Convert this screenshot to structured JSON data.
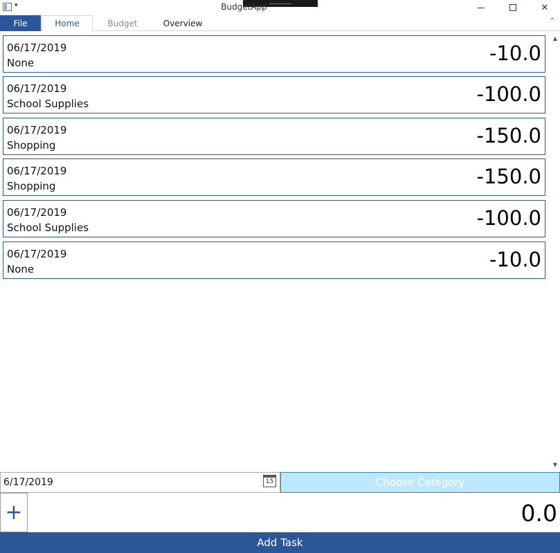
{
  "window": {
    "title": "BudgetApp",
    "qat_arrow": "▾",
    "close_glyph": "✕"
  },
  "ribbon": {
    "tabs": [
      {
        "label": "File",
        "state": "active-application-menu"
      },
      {
        "label": "Home",
        "state": "selected"
      },
      {
        "label": "Budget",
        "state": "disabled"
      },
      {
        "label": "Overview",
        "state": "normal"
      }
    ],
    "collapse_glyph": "⌃"
  },
  "transactions": [
    {
      "date": "06/17/2019",
      "category": "None",
      "amount": "-10.0"
    },
    {
      "date": "06/17/2019",
      "category": "School Supplies",
      "amount": "-100.0"
    },
    {
      "date": "06/17/2019",
      "category": "Shopping",
      "amount": "-150.0"
    },
    {
      "date": "06/17/2019",
      "category": "Shopping",
      "amount": "-150.0"
    },
    {
      "date": "06/17/2019",
      "category": "School Supplies",
      "amount": "-100.0"
    },
    {
      "date": "06/17/2019",
      "category": "None",
      "amount": "-10.0"
    }
  ],
  "scrollbar": {
    "up_glyph": "▲",
    "down_glyph": "▼"
  },
  "form": {
    "date_value": "6/17/2019",
    "calendar_day": "15",
    "category_placeholder": "Choose Category",
    "plus_label": "+",
    "amount_value": "0.0",
    "submit_label": "Add Task"
  },
  "colors": {
    "accent": "#2b579a",
    "category_background": "#bee6fd",
    "disabled_text": "#8a8a8a"
  },
  "icons": {
    "app": "app-window-icon",
    "calendar": "calendar-icon",
    "minimize": "minimize-icon",
    "maximize": "maximize-icon",
    "close": "close-icon"
  }
}
